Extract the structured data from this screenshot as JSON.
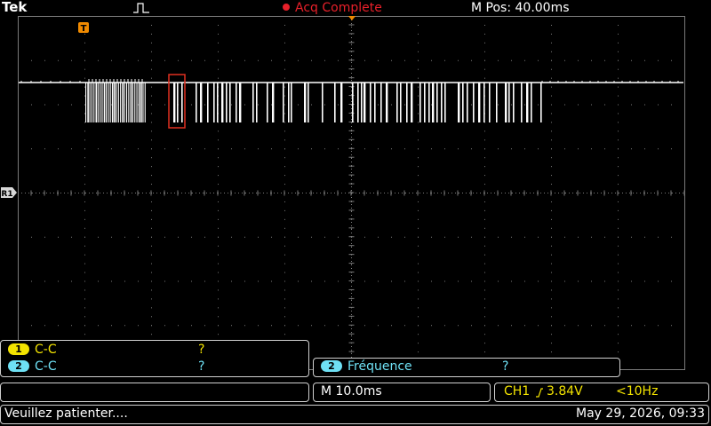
{
  "header": {
    "brand": "Tek",
    "acquisition_status": "Acq Complete",
    "horizontal_position": "M Pos: 40.00ms"
  },
  "markers": {
    "trigger": "T",
    "ref": "R1"
  },
  "measurements": [
    {
      "channel": "1",
      "label": "C-C",
      "value": "?",
      "color": "#f4e400"
    },
    {
      "channel": "2",
      "label": "C-C",
      "value": "?",
      "color": "#6ee0f4"
    }
  ],
  "frequency": {
    "channel": "2",
    "label": "Fréquence",
    "value": "?"
  },
  "timebase": "M 10.0ms",
  "trigger_info": {
    "channel": "CH1",
    "level": "3.84V",
    "frequency": "<10Hz"
  },
  "status": {
    "message": "Veuillez patienter....",
    "datetime": "May 29, 2026, 09:33"
  },
  "colors": {
    "trace": "#ffffff",
    "grid": "#7a7a7a",
    "trigger": "#f08a00",
    "acq": "#e8202a",
    "ch1": "#f4e400",
    "ch2": "#6ee0f4",
    "zoom_box": "#e03020"
  }
}
